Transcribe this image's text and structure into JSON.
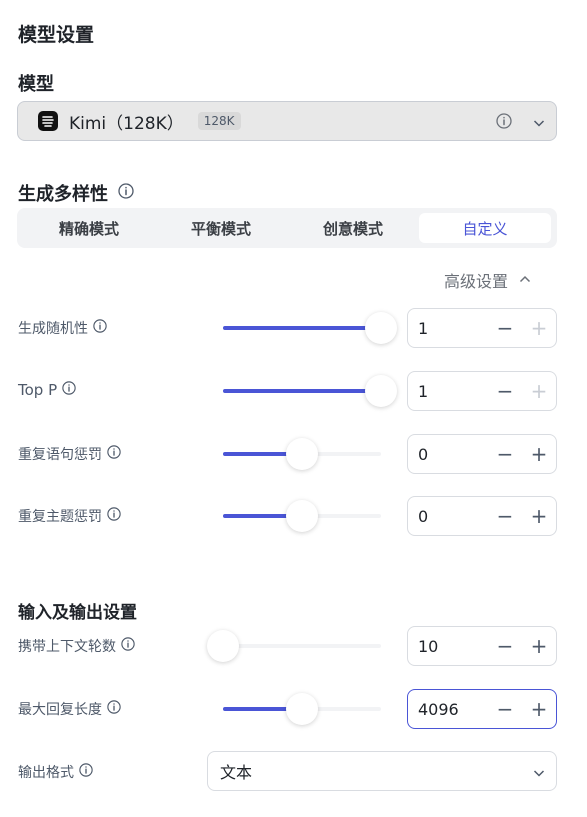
{
  "title": "模型设置",
  "model": {
    "heading": "模型",
    "selected_name": "Kimi（128K）",
    "badge": "128K"
  },
  "diversity": {
    "heading": "生成多样性",
    "tabs": [
      "精确模式",
      "平衡模式",
      "创意模式",
      "自定义"
    ],
    "active_tab": 3
  },
  "advanced": {
    "label": "高级设置",
    "expanded": true
  },
  "params": [
    {
      "label": "生成随机性",
      "value": "1",
      "slider_fraction": 1.0,
      "minus_enabled": true,
      "plus_enabled": false
    },
    {
      "label": "Top P",
      "value": "1",
      "slider_fraction": 1.0,
      "minus_enabled": true,
      "plus_enabled": false
    },
    {
      "label": "重复语句惩罚",
      "value": "0",
      "slider_fraction": 0.5,
      "minus_enabled": true,
      "plus_enabled": true
    },
    {
      "label": "重复主题惩罚",
      "value": "0",
      "slider_fraction": 0.5,
      "minus_enabled": true,
      "plus_enabled": true
    }
  ],
  "io": {
    "heading": "输入及输出设置",
    "params": [
      {
        "label": "携带上下文轮数",
        "value": "10",
        "slider_fraction": 0.0,
        "minus_enabled": true,
        "plus_enabled": true
      },
      {
        "label": "最大回复长度",
        "value": "4096",
        "slider_fraction": 0.5,
        "minus_enabled": true,
        "plus_enabled": true
      }
    ],
    "format_label": "输出格式",
    "format_value": "文本"
  },
  "colors": {
    "accent": "#4a55d6",
    "border": "#d9dce1",
    "text": "#1f2329",
    "muted": "#4e5969"
  },
  "icons": {
    "info": "info-circle-icon",
    "chevron": "chevron-down-icon",
    "up": "chevron-up-icon"
  }
}
